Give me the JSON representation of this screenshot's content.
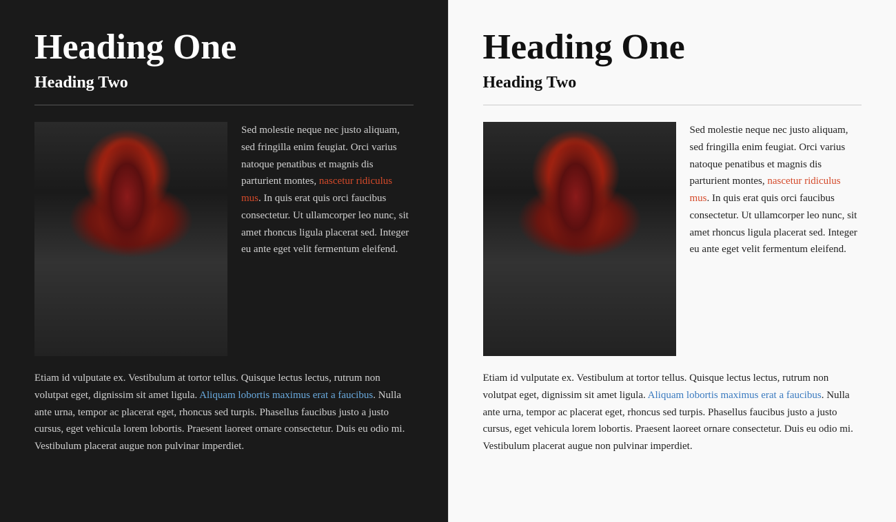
{
  "dark_panel": {
    "heading_one": "Heading One",
    "heading_two": "Heading Two",
    "body_first": "Sed molestie neque nec justo aliquam, sed fringilla enim feugiat. Orci varius natoque penatibus et magnis dis parturient montes, ",
    "link_red": "nascetur ridiculus mus",
    "body_after_link": ". In quis erat quis orci faucibus consectetur. Ut ullamcorper leo nunc, sit amet rhoncus ligula placerat sed. Integer eu ante eget velit fermentum eleifend.",
    "second_para_start": "Etiam id vulputate ex. Vestibulum at tortor tellus. Quisque lectus lectus, rutrum non volutpat eget, dignissim sit amet ligula. ",
    "link_blue": "Aliquam lobortis maximus erat a faucibus",
    "second_para_end": ". Nulla ante urna, tempor ac placerat eget, rhoncus sed turpis. Phasellus faucibus justo a justo cursus, eget vehicula lorem lobortis. Praesent laoreet ornare consectetur. Duis eu odio mi. Vestibulum placerat augue non pulvinar imperdiet."
  },
  "light_panel": {
    "heading_one": "Heading One",
    "heading_two": "Heading Two",
    "body_first": "Sed molestie neque nec justo aliquam, sed fringilla enim feugiat. Orci varius natoque penatibus et magnis dis parturient montes, ",
    "link_red": "nascetur ridiculus mus",
    "body_after_link": ". In quis erat quis orci faucibus consectetur. Ut ullamcorper leo nunc, sit amet rhoncus ligula placerat sed. Integer eu ante eget velit fermentum eleifend.",
    "second_para_start": "Etiam id vulputate ex. Vestibulum at tortor tellus. Quisque lectus lectus, rutrum non volutpat eget, dignissim sit amet ligula. ",
    "link_blue": "Aliquam lobortis maximus erat a faucibus",
    "second_para_end": ". Nulla ante urna, tempor ac placerat eget, rhoncus sed turpis. Phasellus faucibus justo a justo cursus, eget vehicula lorem lobortis. Praesent laoreet ornare consectetur. Duis eu odio mi. Vestibulum placerat augue non pulvinar imperdiet."
  }
}
